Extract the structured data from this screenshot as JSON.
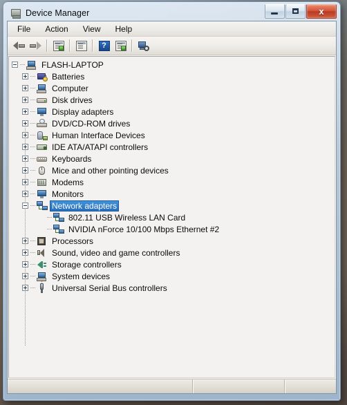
{
  "window": {
    "title": "Device Manager",
    "title_icon": "computer-icon",
    "buttons": {
      "minimize": "minimize-icon",
      "maximize": "maximize-icon",
      "close": "x"
    }
  },
  "menubar": {
    "items": [
      {
        "label": "File"
      },
      {
        "label": "Action"
      },
      {
        "label": "View"
      },
      {
        "label": "Help"
      }
    ]
  },
  "toolbar": {
    "items": [
      {
        "name": "back-button",
        "icon": "back-arrow-icon"
      },
      {
        "name": "forward-button",
        "icon": "forward-arrow-icon"
      },
      {
        "name": "separator-1",
        "icon": "separator"
      },
      {
        "name": "properties-button",
        "icon": "properties-icon"
      },
      {
        "name": "separator-2",
        "icon": "separator"
      },
      {
        "name": "update-driver-button",
        "icon": "document-icon"
      },
      {
        "name": "separator-3",
        "icon": "separator"
      },
      {
        "name": "help-button",
        "icon": "question-mark-icon",
        "glyph": "?"
      },
      {
        "name": "show-hidden-devices-button",
        "icon": "list-icon"
      },
      {
        "name": "separator-4",
        "icon": "separator"
      },
      {
        "name": "scan-hardware-changes-button",
        "icon": "scan-computer-icon"
      }
    ]
  },
  "tree": {
    "root": {
      "label": "FLASH-LAPTOP",
      "icon": "computer-root-icon",
      "expander": "minus"
    },
    "items": [
      {
        "label": "Batteries",
        "icon": "battery-icon",
        "expander": "plus",
        "level": 1,
        "selected": false
      },
      {
        "label": "Computer",
        "icon": "computer-icon",
        "expander": "plus",
        "level": 1,
        "selected": false
      },
      {
        "label": "Disk drives",
        "icon": "disk-drive-icon",
        "expander": "plus",
        "level": 1,
        "selected": false
      },
      {
        "label": "Display adapters",
        "icon": "display-adapter-icon",
        "expander": "plus",
        "level": 1,
        "selected": false
      },
      {
        "label": "DVD/CD-ROM drives",
        "icon": "dvd-drive-icon",
        "expander": "plus",
        "level": 1,
        "selected": false
      },
      {
        "label": "Human Interface Devices",
        "icon": "hid-icon",
        "expander": "plus",
        "level": 1,
        "selected": false
      },
      {
        "label": "IDE ATA/ATAPI controllers",
        "icon": "ide-controller-icon",
        "expander": "plus",
        "level": 1,
        "selected": false
      },
      {
        "label": "Keyboards",
        "icon": "keyboard-icon",
        "expander": "plus",
        "level": 1,
        "selected": false
      },
      {
        "label": "Mice and other pointing devices",
        "icon": "mouse-icon",
        "expander": "plus",
        "level": 1,
        "selected": false
      },
      {
        "label": "Modems",
        "icon": "modem-icon",
        "expander": "plus",
        "level": 1,
        "selected": false
      },
      {
        "label": "Monitors",
        "icon": "monitor-icon",
        "expander": "plus",
        "level": 1,
        "selected": false
      },
      {
        "label": "Network adapters",
        "icon": "network-adapter-icon",
        "expander": "minus",
        "level": 1,
        "selected": true
      },
      {
        "label": "802.11 USB Wireless LAN Card",
        "icon": "network-adapter-icon",
        "expander": "none",
        "level": 2,
        "selected": false
      },
      {
        "label": "NVIDIA nForce 10/100 Mbps Ethernet #2",
        "icon": "network-adapter-icon",
        "expander": "none",
        "level": 2,
        "selected": false
      },
      {
        "label": "Processors",
        "icon": "processor-icon",
        "expander": "plus",
        "level": 1,
        "selected": false
      },
      {
        "label": "Sound, video and game controllers",
        "icon": "sound-icon",
        "expander": "plus",
        "level": 1,
        "selected": false
      },
      {
        "label": "Storage controllers",
        "icon": "storage-controller-icon",
        "expander": "plus",
        "level": 1,
        "selected": false
      },
      {
        "label": "System devices",
        "icon": "system-device-icon",
        "expander": "plus",
        "level": 1,
        "selected": false
      },
      {
        "label": "Universal Serial Bus controllers",
        "icon": "usb-controller-icon",
        "expander": "plus",
        "level": 1,
        "selected": false
      }
    ]
  },
  "statusbar": {
    "panels": [
      {
        "text": ""
      },
      {
        "text": ""
      },
      {
        "text": ""
      }
    ]
  },
  "colors": {
    "selection": "#2a6fc0",
    "close_button": "#c8472b",
    "client_background": "#f4f3f1"
  }
}
